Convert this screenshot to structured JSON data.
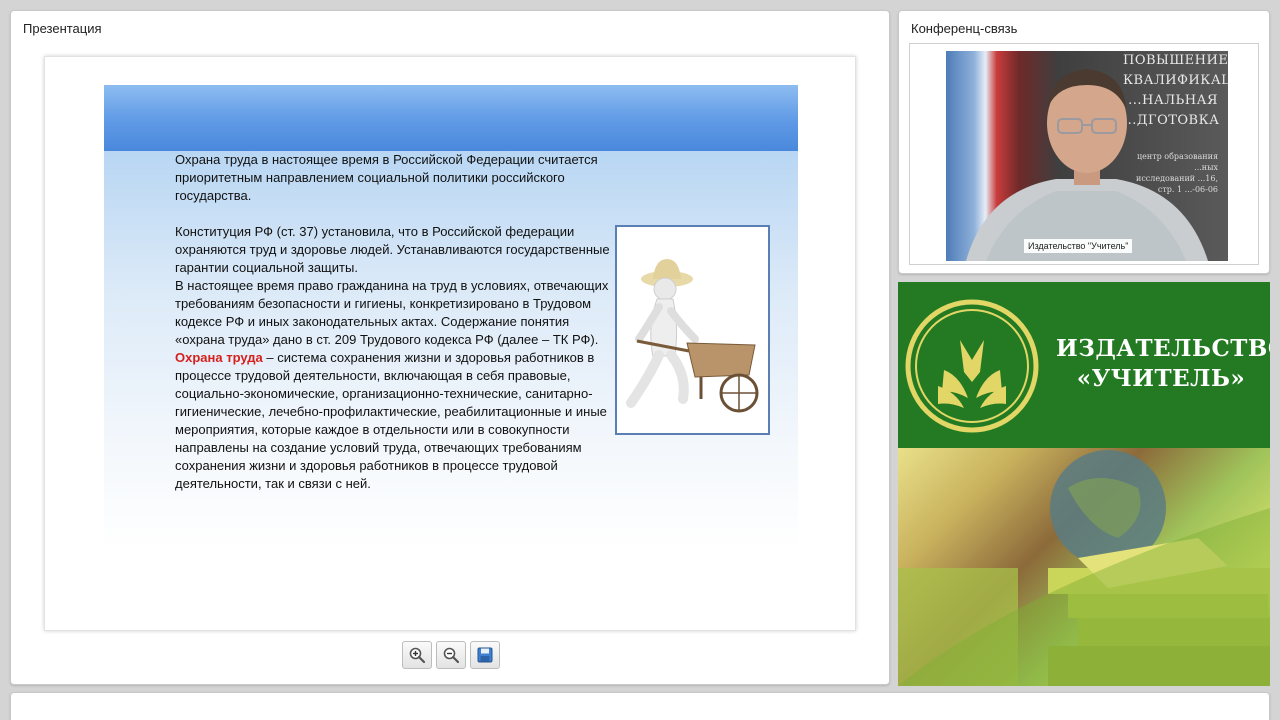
{
  "presentation": {
    "title": "Презентация",
    "slide": {
      "intro": "Охрана труда в настоящее время в Российской Федерации считается приоритетным направлением социальной политики российского государства.",
      "constitution": "Конституция РФ (ст. 37) установила, что в Российской федерации охраняются труд и здоровье людей. Устанавливаются государственные гарантии социальной защиты.",
      "right": "В настоящее время право гражданина на труд в условиях, отвечающих требованиям безопасности и гигиены, конкретизировано в Трудовом кодексе РФ и иных законодательных актах. Содержание понятия «охрана труда» дано в ст. 209 Трудового кодекса РФ (далее – ТК РФ).",
      "term": "Охрана труда",
      "definition": " – система сохранения жизни и здоровья работников в процессе трудовой деятельности, включающая в себя правовые, социально-экономические, организационно-технические, санитарно-гигиенические, лечебно-профилактические, реабилитационные и иные мероприятия, которые каждое в отдельности или  в совокупности направлены на создание условий труда, отвечающих требованиям сохранения жизни и здоровья работников в процессе трудовой деятельности, так и связи с ней."
    },
    "toolbar": {
      "zoom_in": "zoom-in-icon",
      "zoom_out": "zoom-out-icon",
      "save": "save-icon"
    }
  },
  "conference": {
    "title": "Конференц-связь",
    "speaker_label": "Издательство \"Учитель\"",
    "background_text": "ПОВЫШЕНИЕ КВАЛИФИКАЦИИ ...НАЛЬНАЯ ...ДГОТОВКА",
    "background_small": "центр образования ...ных исследований ...16, стр. 1 ...-06-06"
  },
  "publisher": {
    "name_line1": "ИЗДАТЕЛЬСТВО",
    "name_line2": "«УЧИТЕЛЬ»",
    "brand_green": "#237a22",
    "accent_yellow": "#e2d766"
  }
}
